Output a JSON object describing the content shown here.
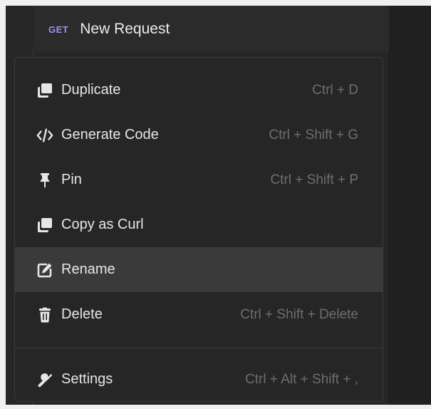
{
  "request": {
    "method": "GET",
    "name": "New Request"
  },
  "menu": {
    "items": [
      {
        "icon": "duplicate-icon",
        "label": "Duplicate",
        "shortcut": "Ctrl + D"
      },
      {
        "icon": "code-icon",
        "label": "Generate Code",
        "shortcut": "Ctrl + Shift + G"
      },
      {
        "icon": "pin-icon",
        "label": "Pin",
        "shortcut": "Ctrl + Shift + P"
      },
      {
        "icon": "copy-icon",
        "label": "Copy as Curl",
        "shortcut": ""
      },
      {
        "icon": "edit-icon",
        "label": "Rename",
        "shortcut": ""
      },
      {
        "icon": "trash-icon",
        "label": "Delete",
        "shortcut": "Ctrl + Shift + Delete"
      },
      {
        "icon": "wrench-icon",
        "label": "Settings",
        "shortcut": "Ctrl + Alt + Shift + ,"
      }
    ],
    "highlighted": "Rename"
  },
  "colors": {
    "method_get": "#a78bfa",
    "menu_bg": "#262626",
    "highlight_bg": "#3a3a3a",
    "shortcut_text": "#6e6e6e"
  }
}
